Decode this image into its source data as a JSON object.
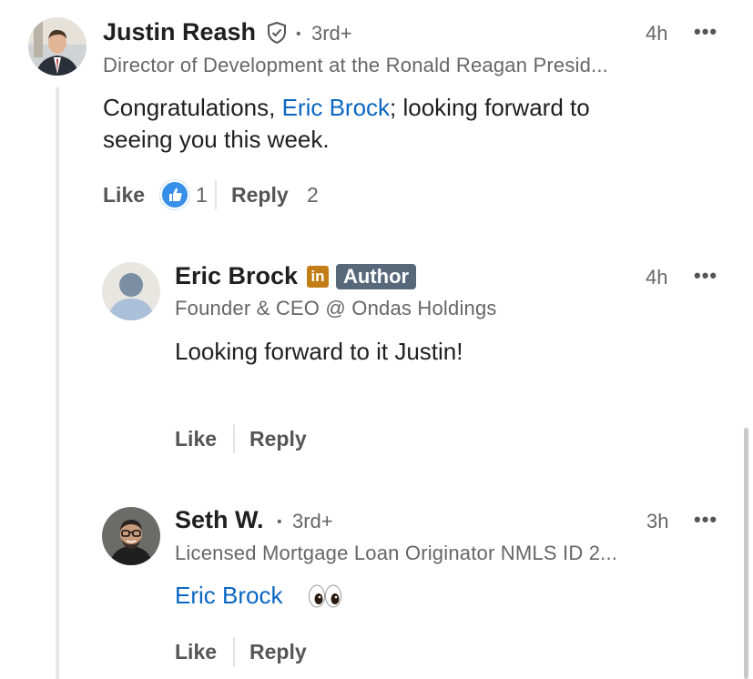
{
  "comments": [
    {
      "name": "Justin Reash",
      "degree": "3rd+",
      "time": "4h",
      "headline": "Director of Development at the Ronald Reagan Presid...",
      "body_prefix": "Congratulations, ",
      "mention": "Eric Brock",
      "body_line1_suffix": "; looking forward to",
      "body_line2": "seeing you this week.",
      "like_label": "Like",
      "like_count": "1",
      "reply_label": "Reply",
      "reply_count": "2",
      "avatar_icon": "person-photo"
    },
    {
      "name": "Eric Brock",
      "badge": "Author",
      "in_badge": "in",
      "time": "4h",
      "headline": "Founder & CEO @ Ondas Holdings",
      "body": "Looking forward to it Justin!",
      "like_label": "Like",
      "reply_label": "Reply",
      "avatar_icon": "default-avatar"
    },
    {
      "name": "Seth W.",
      "degree": "3rd+",
      "time": "3h",
      "headline": "Licensed Mortgage Loan Originator NMLS ID 2...",
      "mention": "Eric Brock",
      "emoji": "eyes",
      "like_label": "Like",
      "reply_label": "Reply",
      "avatar_icon": "person-photo"
    }
  ],
  "more_label": "•••",
  "dot": "•",
  "colors": {
    "mention": "#0a66c2",
    "author_badge": "#56687a",
    "in_badge": "#c37d16",
    "like_blue": "#378fe9"
  }
}
